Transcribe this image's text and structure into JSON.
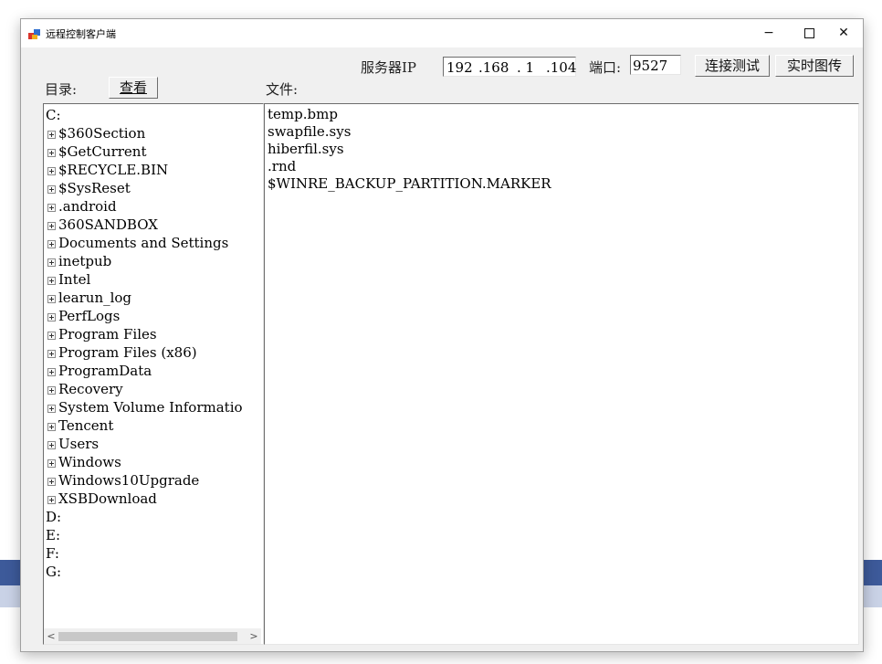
{
  "window": {
    "title": "远程控制客户端",
    "minimize": "−",
    "close": "✕"
  },
  "toolbar": {
    "server_ip_label": "服务器IP",
    "ip_parts": [
      "192",
      ".168",
      ". 1",
      ".104"
    ],
    "port_label": "端口:",
    "port_value": "9527",
    "connect_test": "连接测试",
    "realtime_transfer": "实时图传"
  },
  "dir": {
    "label": "目录:",
    "view_button": "查看"
  },
  "files_label": "文件:",
  "tree": {
    "root": "C:",
    "children": [
      "$360Section",
      "$GetCurrent",
      "$RECYCLE.BIN",
      "$SysReset",
      ".android",
      "360SANDBOX",
      "Documents and Settings",
      "inetpub",
      "Intel",
      "learun_log",
      "PerfLogs",
      "Program Files",
      "Program Files (x86)",
      "ProgramData",
      "Recovery",
      "System Volume Informatio",
      "Tencent",
      "Users",
      "Windows",
      "Windows10Upgrade",
      "XSBDownload"
    ],
    "drives": [
      "D:",
      "E:",
      "F:",
      "G:"
    ]
  },
  "files": [
    "temp.bmp",
    "swapfile.sys",
    "hiberfil.sys",
    ".rnd",
    "$WINRE_BACKUP_PARTITION.MARKER"
  ],
  "scrollbar": {
    "left_arrow": "<",
    "right_arrow": ">"
  }
}
